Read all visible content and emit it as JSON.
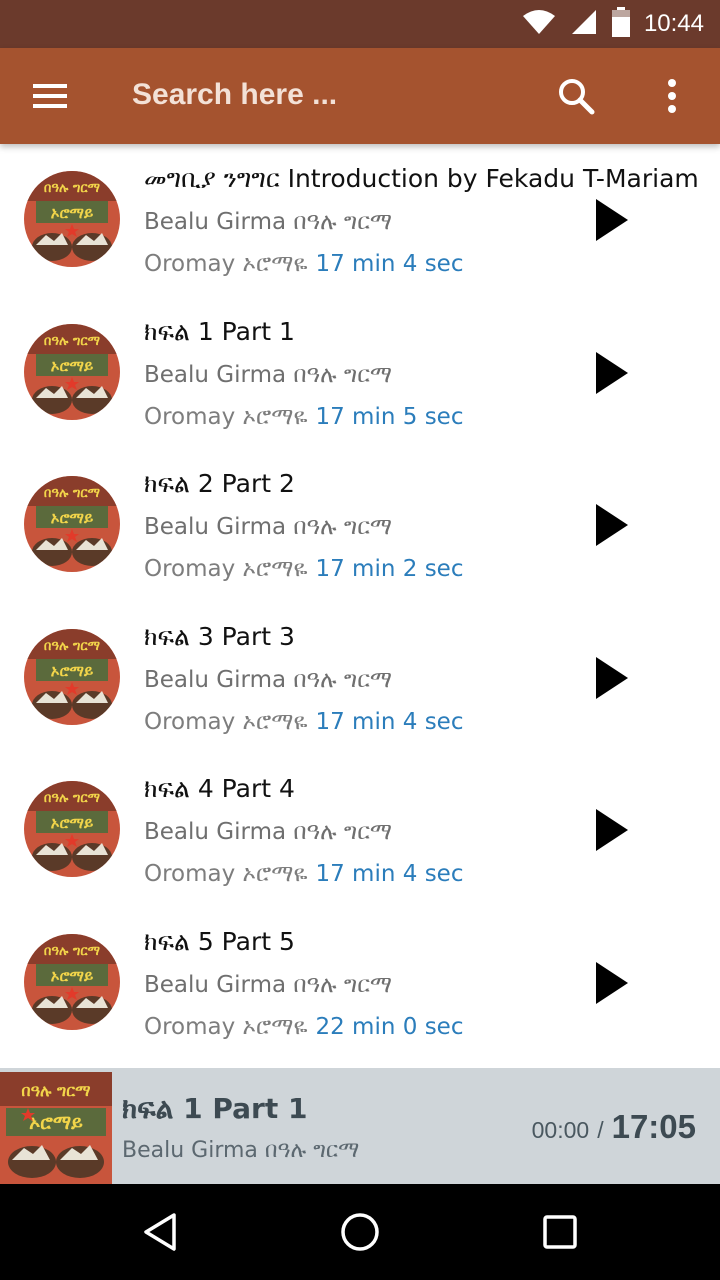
{
  "status_bar": {
    "time": "10:44",
    "icons": [
      "wifi-icon",
      "cell-signal-icon",
      "battery-icon"
    ]
  },
  "app_bar": {
    "search_placeholder": "Search here ...",
    "icons": [
      "menu-icon",
      "search-icon",
      "more-vert-icon"
    ]
  },
  "colors": {
    "status_bar": "#6b3a2c",
    "app_bar": "#a5532f",
    "duration_text": "#2b7dbb",
    "now_playing_bg": "#cfd5d9"
  },
  "tracks": [
    {
      "title": "መግቢያ ንግግር Introduction by Fekadu T-Mariam",
      "artist": "Bealu Girma በዓሉ ግርማ",
      "album": "Oromay ኦሮማዬ",
      "duration": "17 min 4 sec"
    },
    {
      "title": "ክፍል 1 Part 1",
      "artist": "Bealu Girma በዓሉ ግርማ",
      "album": "Oromay ኦሮማዬ",
      "duration": "17 min 5 sec"
    },
    {
      "title": "ክፍል 2 Part 2",
      "artist": "Bealu Girma በዓሉ ግርማ",
      "album": "Oromay ኦሮማዬ",
      "duration": "17 min 2 sec"
    },
    {
      "title": "ክፍል 3 Part 3",
      "artist": "Bealu Girma በዓሉ ግርማ",
      "album": "Oromay ኦሮማዬ",
      "duration": "17 min 4 sec"
    },
    {
      "title": "ክፍል 4 Part 4",
      "artist": "Bealu Girma በዓሉ ግርማ",
      "album": "Oromay ኦሮማዬ",
      "duration": "17 min 4 sec"
    },
    {
      "title": "ክፍል 5 Part 5",
      "artist": "Bealu Girma በዓሉ ግርማ",
      "album": "Oromay ኦሮማዬ",
      "duration": "22 min 0 sec"
    }
  ],
  "now_playing": {
    "title": "ክፍል 1 Part 1",
    "artist": "Bealu Girma በዓሉ ግርማ",
    "current_time": "00:00",
    "separator": "/",
    "total_time": "17:05"
  },
  "book_cover": {
    "top_text": "በዓሉ ግርማ",
    "title_text": "ኦሮማይ"
  },
  "nav_bar": {
    "icons": [
      "back-icon",
      "home-icon",
      "recents-icon"
    ]
  }
}
